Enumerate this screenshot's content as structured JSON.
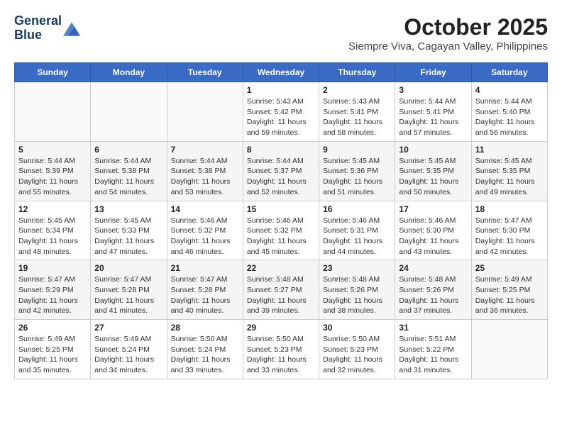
{
  "header": {
    "logo_line1": "General",
    "logo_line2": "Blue",
    "title": "October 2025",
    "subtitle": "Siempre Viva, Cagayan Valley, Philippines"
  },
  "days_of_week": [
    "Sunday",
    "Monday",
    "Tuesday",
    "Wednesday",
    "Thursday",
    "Friday",
    "Saturday"
  ],
  "weeks": [
    [
      {
        "day": "",
        "sunrise": "",
        "sunset": "",
        "daylight": ""
      },
      {
        "day": "",
        "sunrise": "",
        "sunset": "",
        "daylight": ""
      },
      {
        "day": "",
        "sunrise": "",
        "sunset": "",
        "daylight": ""
      },
      {
        "day": "1",
        "sunrise": "Sunrise: 5:43 AM",
        "sunset": "Sunset: 5:42 PM",
        "daylight": "Daylight: 11 hours and 59 minutes."
      },
      {
        "day": "2",
        "sunrise": "Sunrise: 5:43 AM",
        "sunset": "Sunset: 5:41 PM",
        "daylight": "Daylight: 11 hours and 58 minutes."
      },
      {
        "day": "3",
        "sunrise": "Sunrise: 5:44 AM",
        "sunset": "Sunset: 5:41 PM",
        "daylight": "Daylight: 11 hours and 57 minutes."
      },
      {
        "day": "4",
        "sunrise": "Sunrise: 5:44 AM",
        "sunset": "Sunset: 5:40 PM",
        "daylight": "Daylight: 11 hours and 56 minutes."
      }
    ],
    [
      {
        "day": "5",
        "sunrise": "Sunrise: 5:44 AM",
        "sunset": "Sunset: 5:39 PM",
        "daylight": "Daylight: 11 hours and 55 minutes."
      },
      {
        "day": "6",
        "sunrise": "Sunrise: 5:44 AM",
        "sunset": "Sunset: 5:38 PM",
        "daylight": "Daylight: 11 hours and 54 minutes."
      },
      {
        "day": "7",
        "sunrise": "Sunrise: 5:44 AM",
        "sunset": "Sunset: 5:38 PM",
        "daylight": "Daylight: 11 hours and 53 minutes."
      },
      {
        "day": "8",
        "sunrise": "Sunrise: 5:44 AM",
        "sunset": "Sunset: 5:37 PM",
        "daylight": "Daylight: 11 hours and 52 minutes."
      },
      {
        "day": "9",
        "sunrise": "Sunrise: 5:45 AM",
        "sunset": "Sunset: 5:36 PM",
        "daylight": "Daylight: 11 hours and 51 minutes."
      },
      {
        "day": "10",
        "sunrise": "Sunrise: 5:45 AM",
        "sunset": "Sunset: 5:35 PM",
        "daylight": "Daylight: 11 hours and 50 minutes."
      },
      {
        "day": "11",
        "sunrise": "Sunrise: 5:45 AM",
        "sunset": "Sunset: 5:35 PM",
        "daylight": "Daylight: 11 hours and 49 minutes."
      }
    ],
    [
      {
        "day": "12",
        "sunrise": "Sunrise: 5:45 AM",
        "sunset": "Sunset: 5:34 PM",
        "daylight": "Daylight: 11 hours and 48 minutes."
      },
      {
        "day": "13",
        "sunrise": "Sunrise: 5:45 AM",
        "sunset": "Sunset: 5:33 PM",
        "daylight": "Daylight: 11 hours and 47 minutes."
      },
      {
        "day": "14",
        "sunrise": "Sunrise: 5:46 AM",
        "sunset": "Sunset: 5:32 PM",
        "daylight": "Daylight: 11 hours and 46 minutes."
      },
      {
        "day": "15",
        "sunrise": "Sunrise: 5:46 AM",
        "sunset": "Sunset: 5:32 PM",
        "daylight": "Daylight: 11 hours and 45 minutes."
      },
      {
        "day": "16",
        "sunrise": "Sunrise: 5:46 AM",
        "sunset": "Sunset: 5:31 PM",
        "daylight": "Daylight: 11 hours and 44 minutes."
      },
      {
        "day": "17",
        "sunrise": "Sunrise: 5:46 AM",
        "sunset": "Sunset: 5:30 PM",
        "daylight": "Daylight: 11 hours and 43 minutes."
      },
      {
        "day": "18",
        "sunrise": "Sunrise: 5:47 AM",
        "sunset": "Sunset: 5:30 PM",
        "daylight": "Daylight: 11 hours and 42 minutes."
      }
    ],
    [
      {
        "day": "19",
        "sunrise": "Sunrise: 5:47 AM",
        "sunset": "Sunset: 5:29 PM",
        "daylight": "Daylight: 11 hours and 42 minutes."
      },
      {
        "day": "20",
        "sunrise": "Sunrise: 5:47 AM",
        "sunset": "Sunset: 5:28 PM",
        "daylight": "Daylight: 11 hours and 41 minutes."
      },
      {
        "day": "21",
        "sunrise": "Sunrise: 5:47 AM",
        "sunset": "Sunset: 5:28 PM",
        "daylight": "Daylight: 11 hours and 40 minutes."
      },
      {
        "day": "22",
        "sunrise": "Sunrise: 5:48 AM",
        "sunset": "Sunset: 5:27 PM",
        "daylight": "Daylight: 11 hours and 39 minutes."
      },
      {
        "day": "23",
        "sunrise": "Sunrise: 5:48 AM",
        "sunset": "Sunset: 5:26 PM",
        "daylight": "Daylight: 11 hours and 38 minutes."
      },
      {
        "day": "24",
        "sunrise": "Sunrise: 5:48 AM",
        "sunset": "Sunset: 5:26 PM",
        "daylight": "Daylight: 11 hours and 37 minutes."
      },
      {
        "day": "25",
        "sunrise": "Sunrise: 5:49 AM",
        "sunset": "Sunset: 5:25 PM",
        "daylight": "Daylight: 11 hours and 36 minutes."
      }
    ],
    [
      {
        "day": "26",
        "sunrise": "Sunrise: 5:49 AM",
        "sunset": "Sunset: 5:25 PM",
        "daylight": "Daylight: 11 hours and 35 minutes."
      },
      {
        "day": "27",
        "sunrise": "Sunrise: 5:49 AM",
        "sunset": "Sunset: 5:24 PM",
        "daylight": "Daylight: 11 hours and 34 minutes."
      },
      {
        "day": "28",
        "sunrise": "Sunrise: 5:50 AM",
        "sunset": "Sunset: 5:24 PM",
        "daylight": "Daylight: 11 hours and 33 minutes."
      },
      {
        "day": "29",
        "sunrise": "Sunrise: 5:50 AM",
        "sunset": "Sunset: 5:23 PM",
        "daylight": "Daylight: 11 hours and 33 minutes."
      },
      {
        "day": "30",
        "sunrise": "Sunrise: 5:50 AM",
        "sunset": "Sunset: 5:23 PM",
        "daylight": "Daylight: 11 hours and 32 minutes."
      },
      {
        "day": "31",
        "sunrise": "Sunrise: 5:51 AM",
        "sunset": "Sunset: 5:22 PM",
        "daylight": "Daylight: 11 hours and 31 minutes."
      },
      {
        "day": "",
        "sunrise": "",
        "sunset": "",
        "daylight": ""
      }
    ]
  ]
}
